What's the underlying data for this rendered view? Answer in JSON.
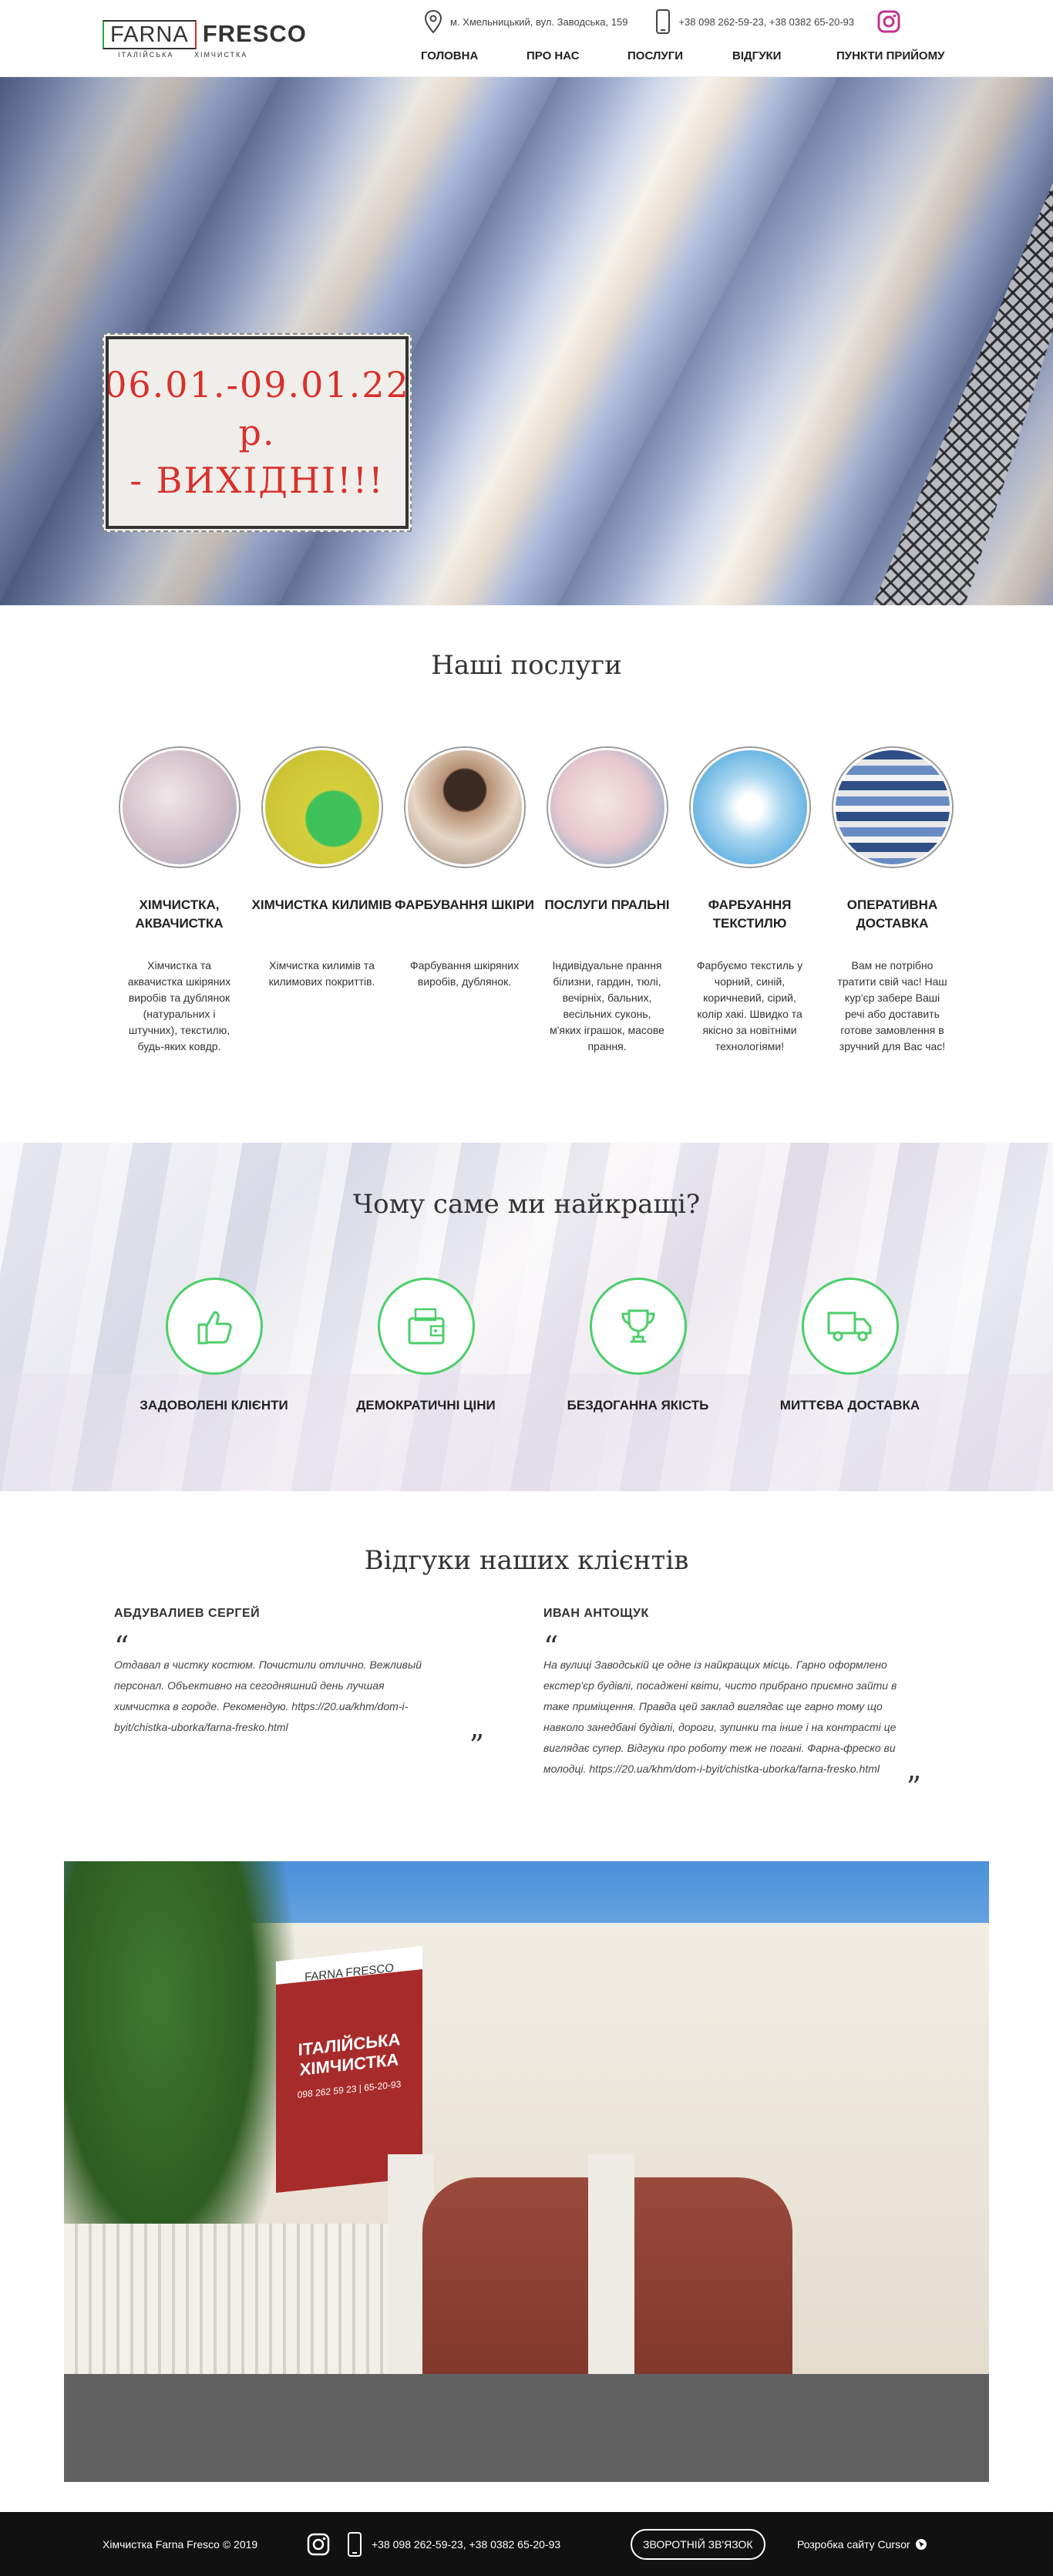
{
  "header": {
    "logo": {
      "farna": "FARNA",
      "fresco": "FRESCO",
      "sub_left": "ІТАЛІЙСЬКА",
      "sub_right": "ХІМЧИСТКА"
    },
    "address": "м. Хмельницький, вул. Заводська, 159",
    "phones": "+38 098 262-59-23, +38 0382 65-20-93",
    "nav": [
      {
        "label": "ГОЛОВНА"
      },
      {
        "label": "ПРО НАС"
      },
      {
        "label": "ПОСЛУГИ"
      },
      {
        "label": "ВІДГУКИ"
      },
      {
        "label": "ПУНКТИ ПРИЙОМУ"
      }
    ]
  },
  "hero": {
    "promo_line1": "06.01.-09.01.22 р.",
    "promo_line2": "- ВИХІДНІ!!!"
  },
  "services": {
    "title": "Наші послуги",
    "items": [
      {
        "name": "ХІМЧИСТКА, АКВАЧИСТКА",
        "desc": "Хімчистка та аквачистка шкіряних виробів та дублянок (натуральних і штучних), текстилю, будь-яких ковдр.",
        "color": "#d9c8cf"
      },
      {
        "name": "ХІМЧИСТКА КИЛИМІВ",
        "desc": "Хімчистка килимів та килимових покриттів.",
        "color": "#c9c43a"
      },
      {
        "name": "ФАРБУВАННЯ ШКІРИ",
        "desc": "Фарбування шкіряних виробів, дублянок.",
        "color": "#8a6a55"
      },
      {
        "name": "ПОСЛУГИ ПРАЛЬНІ",
        "desc": "Індивідуальне прання білизни, гардин, тюлі, вечірніх, бальних, весільних суконь, м'яких іграшок, масове прання.",
        "color": "#e3cfd3"
      },
      {
        "name": "ФАРБУАННЯ ТЕКСТИЛЮ",
        "desc": "Фарбуємо текстиль у чорний, синій, коричневий, сірий, колір хакі. Швидко та якісно за новітніми технологіями!",
        "color": "#a9d3ea"
      },
      {
        "name": "ОПЕРАТИВНА ДОСТАВКА",
        "desc": "Вам не потрібно тратити свій час! Наш кур'єр забере Ваші речі або доставить готове замовлення в зручний для Вас час!",
        "color": "#6f86a9"
      }
    ]
  },
  "why": {
    "title": "Чому саме ми найкращі?",
    "items": [
      {
        "label": "ЗАДОВОЛЕНІ КЛІЄНТИ",
        "icon": "thumbs-up-icon"
      },
      {
        "label": "ДЕМОКРАТИЧНІ ЦІНИ",
        "icon": "wallet-icon"
      },
      {
        "label": "БЕЗДОГАННА ЯКІСТЬ",
        "icon": "trophy-icon"
      },
      {
        "label": "МИТТЄВА ДОСТАВКА",
        "icon": "truck-icon"
      }
    ],
    "accent": "#4ccf6a"
  },
  "reviews": {
    "title": "Відгуки наших клієнтів",
    "items": [
      {
        "author": "АБДУВАЛИЕВ СЕРГЕЙ",
        "text": "Отдавал в чистку костюм. Почистили отлично. Вежливый персонал. Объективно на сегодняшний день лучшая химчистка в городе. Рекомендую. https://20.ua/khm/dom-i-byit/chistka-uborka/farna-fresko.html"
      },
      {
        "author": "ИВАН АНТОЩУК",
        "text": "На вулиці Заводській це одне із найкращих місць. Гарно оформлено екстер'єр будівлі, посаджені квіти, чисто прибрано приємно зайти в таке приміщення. Правда цей заклад виглядає ще гарно тому що навколо занедбані будівлі, дороги, зупинки та інше і на контрасті це виглядає супер. Відгуки про роботу теж не погані. Фарна-фреско ви молодці. https://20.ua/khm/dom-i-byit/chistka-uborka/farna-fresko.html"
      }
    ]
  },
  "photo": {
    "sign_top": "FARNA FRESCO",
    "sign_main": "ІТАЛІЙСЬКА ХІМЧИСТКА",
    "sign_phone": "098 262 59 23 | 65-20-93"
  },
  "footer": {
    "copyright": "Хімчистка Farna Fresco © 2019",
    "phones": "+38 098 262-59-23, +38 0382 65-20-93",
    "callback_button": "ЗВОРОТНІЙ ЗВ'ЯЗОК",
    "developer": "Розробка сайту Cursor"
  }
}
